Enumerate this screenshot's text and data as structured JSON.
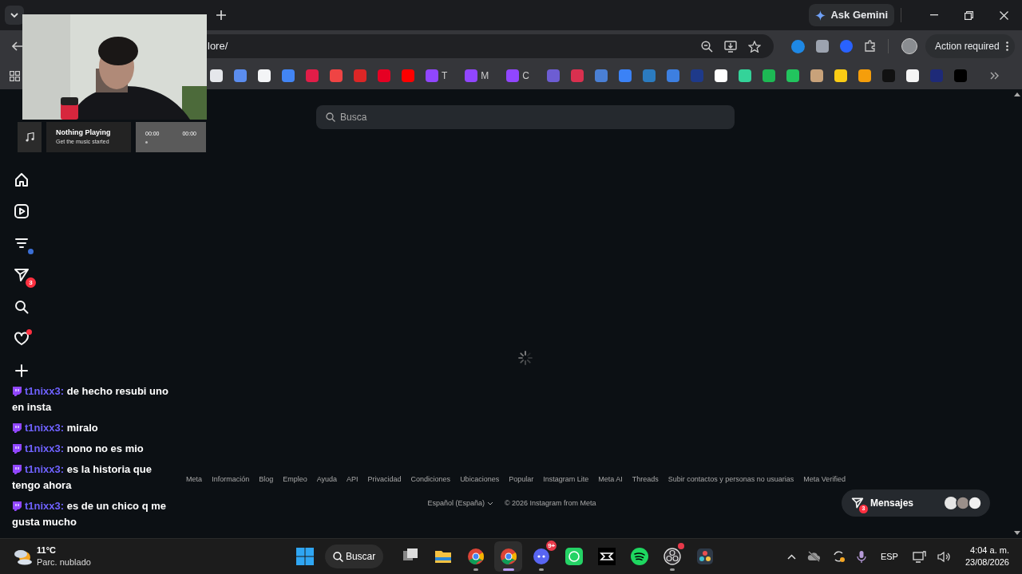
{
  "browser": {
    "ask_gemini": "Ask Gemini",
    "address": "lore/",
    "action_required": "Action required",
    "bookmarks": [
      {
        "color": "#e5e7eb"
      },
      {
        "color": "#5b8def"
      },
      {
        "color": "#f3f4f6"
      },
      {
        "color": "#4285f4"
      },
      {
        "color": "#e11d48"
      },
      {
        "color": "#ef4444"
      },
      {
        "color": "#dc2626"
      },
      {
        "color": "#e60023"
      },
      {
        "color": "#ff0000"
      },
      {
        "color": "#9146ff",
        "label": "T"
      },
      {
        "color": "#9146ff",
        "label": "M"
      },
      {
        "color": "#9146ff",
        "label": "C"
      },
      {
        "color": "#6d5dd3"
      },
      {
        "color": "#d9304f"
      },
      {
        "color": "#4a7fd4"
      },
      {
        "color": "#3b82f6"
      },
      {
        "color": "#2b7bc0"
      },
      {
        "color": "#3d7fe0"
      },
      {
        "color": "#1e3a8a"
      },
      {
        "color": "#ffffff"
      },
      {
        "color": "#34d399"
      },
      {
        "color": "#1db954"
      },
      {
        "color": "#22c55e"
      },
      {
        "color": "#c8a27a"
      },
      {
        "color": "#facc15"
      },
      {
        "color": "#f59e0b"
      },
      {
        "color": "#111111"
      },
      {
        "color": "#f5f5f5"
      },
      {
        "color": "#1e2a78"
      },
      {
        "color": "#000000"
      }
    ]
  },
  "music_widget": {
    "title": "Nothing Playing",
    "subtitle": "Get the music started",
    "elapsed": "00:00",
    "total": "00:00"
  },
  "sidebar": {
    "items": [
      {
        "kind": "home"
      },
      {
        "kind": "reels"
      },
      {
        "kind": "list",
        "color": "#3b6fd6"
      },
      {
        "kind": "send",
        "badge": "3"
      },
      {
        "kind": "search"
      },
      {
        "kind": "heart",
        "color": "#ff3040"
      },
      {
        "kind": "plus"
      }
    ]
  },
  "search": {
    "placeholder": "Busca"
  },
  "chat": [
    {
      "user": "t1nixx3:",
      "text": "de hecho resubi uno en insta"
    },
    {
      "user": "t1nixx3:",
      "text": "miralo"
    },
    {
      "user": "t1nixx3:",
      "text": "nono no es mio"
    },
    {
      "user": "t1nixx3:",
      "text": "es la historia que tengo ahora"
    },
    {
      "user": "t1nixx3:",
      "text": "es de un chico q me gusta mucho"
    }
  ],
  "footer": {
    "links": [
      "Meta",
      "Información",
      "Blog",
      "Empleo",
      "Ayuda",
      "API",
      "Privacidad",
      "Condiciones",
      "Ubicaciones",
      "Popular",
      "Instagram Lite",
      "Meta AI",
      "Threads",
      "Subir contactos y personas no usuarias",
      "Meta Verified"
    ],
    "language": "Español (España)",
    "copyright": "© 2026 Instagram from Meta"
  },
  "messages_button": {
    "label": "Mensajes",
    "badge": "3"
  },
  "taskbar": {
    "temperature": "11°C",
    "weather": "Parc. nublado",
    "search": "Buscar",
    "apps": [
      {
        "kind": "files",
        "selected": false,
        "running": false
      },
      {
        "kind": "folder",
        "selected": false,
        "running": false
      },
      {
        "kind": "chrome",
        "selected": false,
        "running": true
      },
      {
        "kind": "chrome",
        "selected": true,
        "running": true
      },
      {
        "kind": "discord",
        "selected": false,
        "running": true,
        "badge": "9+"
      },
      {
        "kind": "whatsapp",
        "selected": false,
        "running": false
      },
      {
        "kind": "capcut",
        "selected": false,
        "running": false
      },
      {
        "kind": "spotify",
        "selected": false,
        "running": false
      },
      {
        "kind": "obs",
        "selected": false,
        "running": true,
        "alert": true
      },
      {
        "kind": "resolve",
        "selected": false,
        "running": false
      }
    ],
    "language": "ESP",
    "time": "4:04 a. m.",
    "date": "23/08/2026"
  }
}
